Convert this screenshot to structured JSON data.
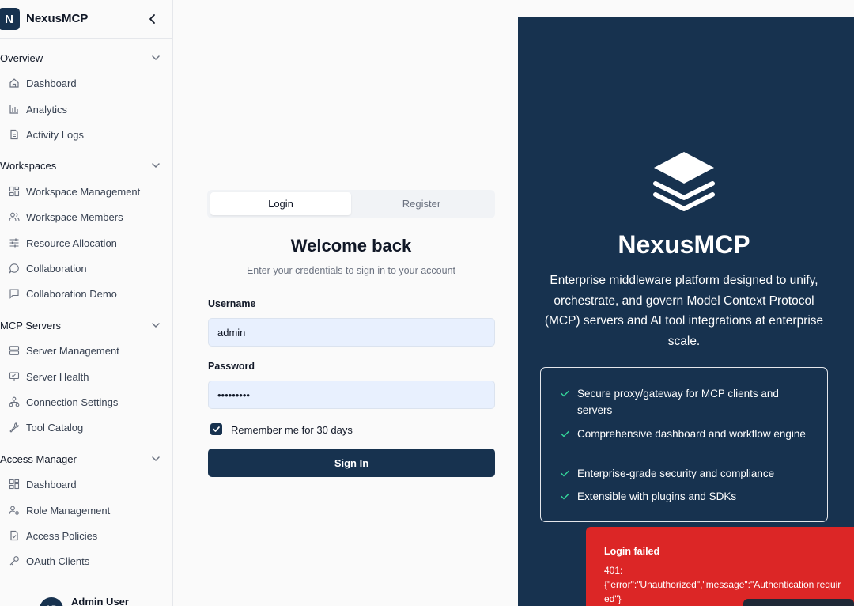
{
  "app": {
    "logo_letter": "N",
    "name": "NexusMCP"
  },
  "sidebar": {
    "groups": [
      {
        "title": "Overview",
        "items": [
          {
            "label": "Dashboard",
            "icon": "home-icon"
          },
          {
            "label": "Analytics",
            "icon": "bar-chart-icon"
          },
          {
            "label": "Activity Logs",
            "icon": "file-text-icon"
          }
        ]
      },
      {
        "title": "Workspaces",
        "items": [
          {
            "label": "Workspace Management",
            "icon": "layout-grid-icon"
          },
          {
            "label": "Workspace Members",
            "icon": "users-icon"
          },
          {
            "label": "Resource Allocation",
            "icon": "sliders-icon"
          },
          {
            "label": "Collaboration",
            "icon": "message-circle-icon"
          },
          {
            "label": "Collaboration Demo",
            "icon": "message-square-icon"
          }
        ]
      },
      {
        "title": "MCP Servers",
        "items": [
          {
            "label": "Server Management",
            "icon": "server-icon"
          },
          {
            "label": "Server Health",
            "icon": "monitor-icon"
          },
          {
            "label": "Connection Settings",
            "icon": "network-icon"
          },
          {
            "label": "Tool Catalog",
            "icon": "wrench-icon"
          }
        ]
      },
      {
        "title": "Access Manager",
        "items": [
          {
            "label": "Dashboard",
            "icon": "layout-grid-icon"
          },
          {
            "label": "Role Management",
            "icon": "user-cog-icon"
          },
          {
            "label": "Access Policies",
            "icon": "file-check-icon"
          },
          {
            "label": "OAuth Clients",
            "icon": "key-icon"
          }
        ]
      }
    ],
    "user": {
      "initials": "AD",
      "name": "Admin User"
    }
  },
  "auth": {
    "tabs": {
      "login": "Login",
      "register": "Register"
    },
    "title": "Welcome back",
    "subtitle": "Enter your credentials to sign in to your account",
    "username_label": "Username",
    "username_value": "admin",
    "password_label": "Password",
    "password_value": "•••••••••",
    "remember_label": "Remember me for 30 days",
    "submit_label": "Sign In"
  },
  "brand": {
    "title": "NexusMCP",
    "description": "Enterprise middleware platform designed to unify, orchestrate, and govern Model Context Protocol (MCP) servers and AI tool integrations at enterprise scale.",
    "features": [
      "Secure proxy/gateway for MCP clients and servers",
      "Comprehensive dashboard and workflow engine",
      "Enterprise-grade security and compliance",
      "Extensible with plugins and SDKs"
    ]
  },
  "toast": {
    "title": "Login failed",
    "line1": "401:",
    "line2": "{\"error\":\"Unauthorized\",\"message\":\"Authentication required\"}"
  },
  "colors": {
    "primary": "#17324f",
    "error": "#dc2626",
    "success_check": "#34d399"
  }
}
